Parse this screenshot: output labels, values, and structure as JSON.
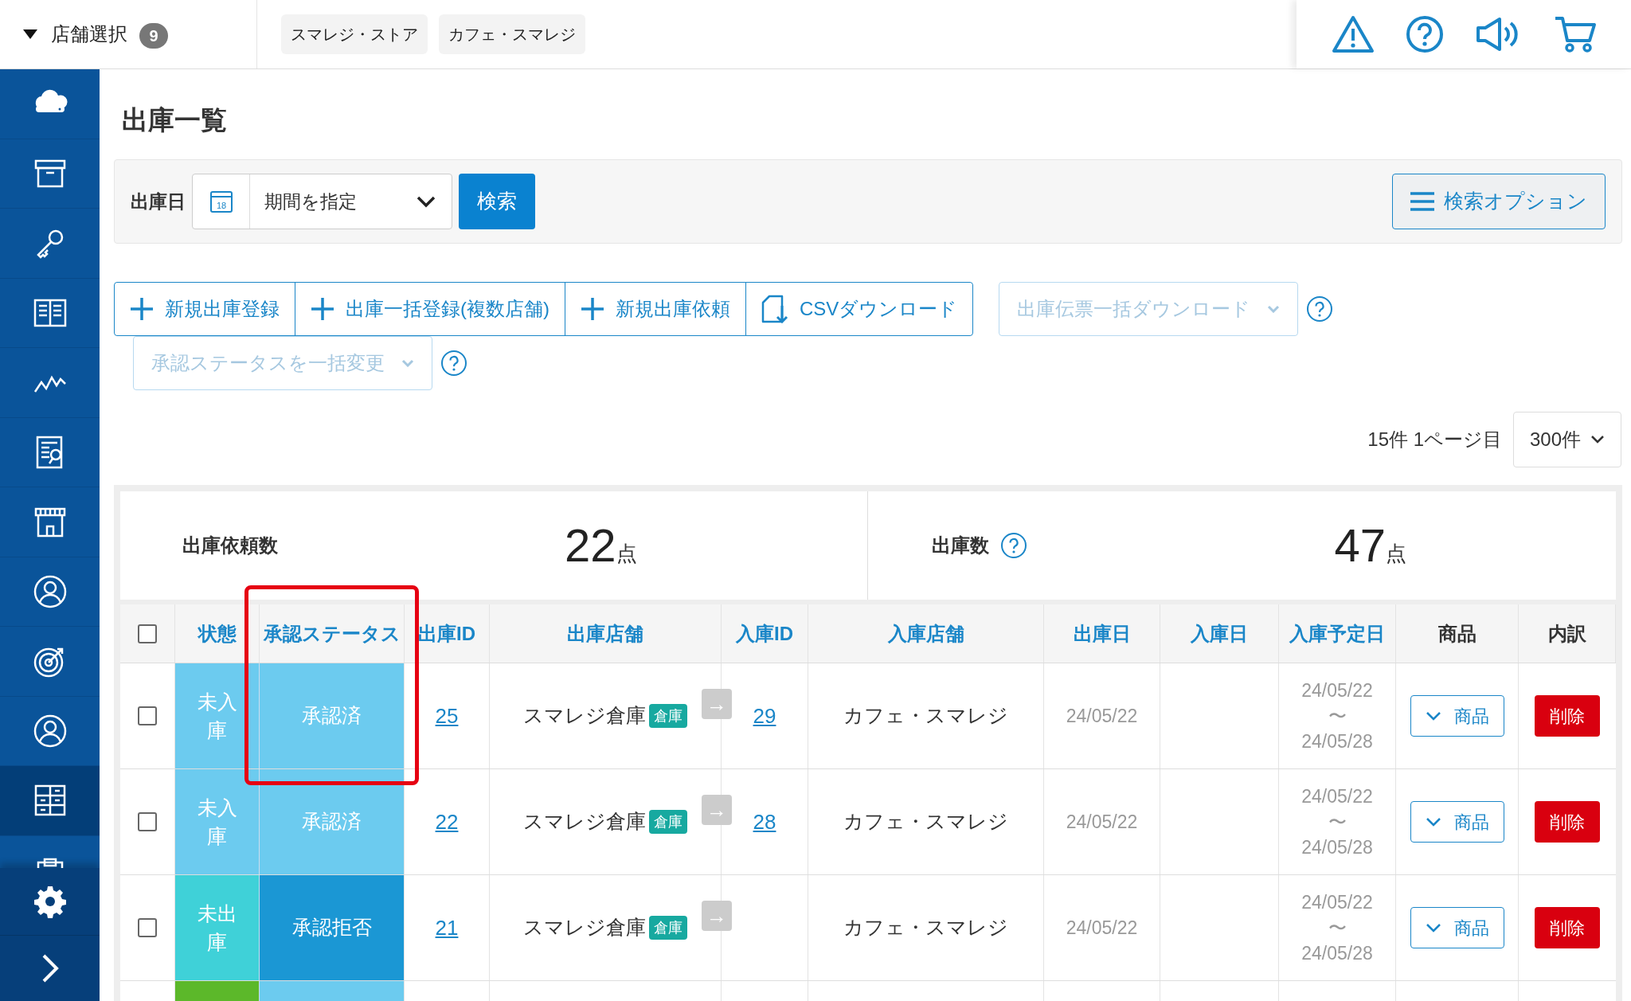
{
  "header": {
    "store_selector": {
      "label": "店舗選択",
      "count": "9",
      "expanded": true
    },
    "store_chips": [
      "スマレジ・ストア",
      "カフェ・スマレジ"
    ]
  },
  "sidebar": {
    "items": [
      {
        "selected": false
      },
      {
        "selected": false
      },
      {
        "selected": false
      },
      {
        "selected": false
      },
      {
        "selected": false
      },
      {
        "selected": false
      },
      {
        "selected": false
      },
      {
        "selected": false
      },
      {
        "selected": false
      },
      {
        "selected": false
      },
      {
        "selected": true
      },
      {
        "selected": false
      }
    ]
  },
  "page_title": "出庫一覧",
  "search_panel": {
    "label": "出庫日",
    "calendar_day": "18",
    "period_select": "期間を指定",
    "search_button": "検索",
    "options_button": "検索オプション"
  },
  "actions": [
    {
      "label": "新規出庫登録",
      "kind": "plus"
    },
    {
      "label": "出庫一括登録(複数店舗)",
      "kind": "plus"
    },
    {
      "label": "新規出庫依頼",
      "kind": "plus"
    },
    {
      "label": "CSVダウンロード",
      "kind": "download"
    }
  ],
  "bulk_dropdowns": [
    {
      "label": "出庫伝票一括ダウンロード",
      "disabled": true
    },
    {
      "label": "承認ステータスを一括変更",
      "disabled": true
    }
  ],
  "pagination": {
    "summary": "15件 1ページ目",
    "per_page": "300件"
  },
  "summary": [
    {
      "label": "出庫依頼数",
      "value": "22",
      "unit": "点",
      "help": false
    },
    {
      "label": "出庫数",
      "value": "47",
      "unit": "点",
      "help": true
    }
  ],
  "table": {
    "all_checked": false,
    "columns": [
      {
        "label": "状態",
        "sortable": true,
        "highlighted": false
      },
      {
        "label": "承認ステータス",
        "sortable": true,
        "highlighted": true
      },
      {
        "label": "出庫ID",
        "sortable": true,
        "highlighted": false
      },
      {
        "label": "出庫店舗",
        "sortable": true,
        "highlighted": false
      },
      {
        "label": "入庫ID",
        "sortable": true,
        "highlighted": false
      },
      {
        "label": "入庫店舗",
        "sortable": true,
        "highlighted": false
      },
      {
        "label": "出庫日",
        "sortable": true,
        "highlighted": false
      },
      {
        "label": "入庫日",
        "sortable": true,
        "highlighted": false
      },
      {
        "label": "入庫予定日",
        "sortable": true,
        "highlighted": false
      },
      {
        "label": "商品",
        "sortable": false,
        "highlighted": false
      },
      {
        "label": "内訳",
        "sortable": false,
        "highlighted": false
      }
    ],
    "rows": [
      {
        "checked": false,
        "status": {
          "label": "未入庫",
          "color": "#6ccbef"
        },
        "approval": {
          "label": "承認済",
          "color": "#6ccbef"
        },
        "out_id": "25",
        "out_store": "スマレジ倉庫",
        "out_store_tag": "倉庫",
        "arrow": "→",
        "in_id": "29",
        "in_store": "カフェ・スマレジ",
        "out_date": "24/05/22",
        "planned_from": "24/05/22",
        "planned_sep": "〜",
        "planned_to": "24/05/28",
        "goods_button": "商品",
        "delete_button": "削除"
      },
      {
        "checked": false,
        "status": {
          "label": "未入庫",
          "color": "#6ccbef"
        },
        "approval": {
          "label": "承認済",
          "color": "#6ccbef"
        },
        "out_id": "22",
        "out_store": "スマレジ倉庫",
        "out_store_tag": "倉庫",
        "arrow": "→",
        "in_id": "28",
        "in_store": "カフェ・スマレジ",
        "out_date": "24/05/22",
        "planned_from": "24/05/22",
        "planned_sep": "〜",
        "planned_to": "24/05/28",
        "goods_button": "商品",
        "delete_button": "削除"
      },
      {
        "checked": false,
        "status": {
          "label": "未出庫",
          "color": "#3fd1d8"
        },
        "approval": {
          "label": "承認拒否",
          "color": "#1b97d4"
        },
        "out_id": "21",
        "out_store": "スマレジ倉庫",
        "out_store_tag": "倉庫",
        "arrow": "→",
        "in_store": "カフェ・スマレジ",
        "out_date": "24/05/22",
        "planned_from": "24/05/22",
        "planned_sep": "〜",
        "planned_to": "24/05/28",
        "goods_button": "商品",
        "delete_button": "削除"
      },
      {
        "status": {
          "color": "#5cb82a"
        },
        "approval": {
          "color": "#6ccbef"
        }
      }
    ]
  }
}
